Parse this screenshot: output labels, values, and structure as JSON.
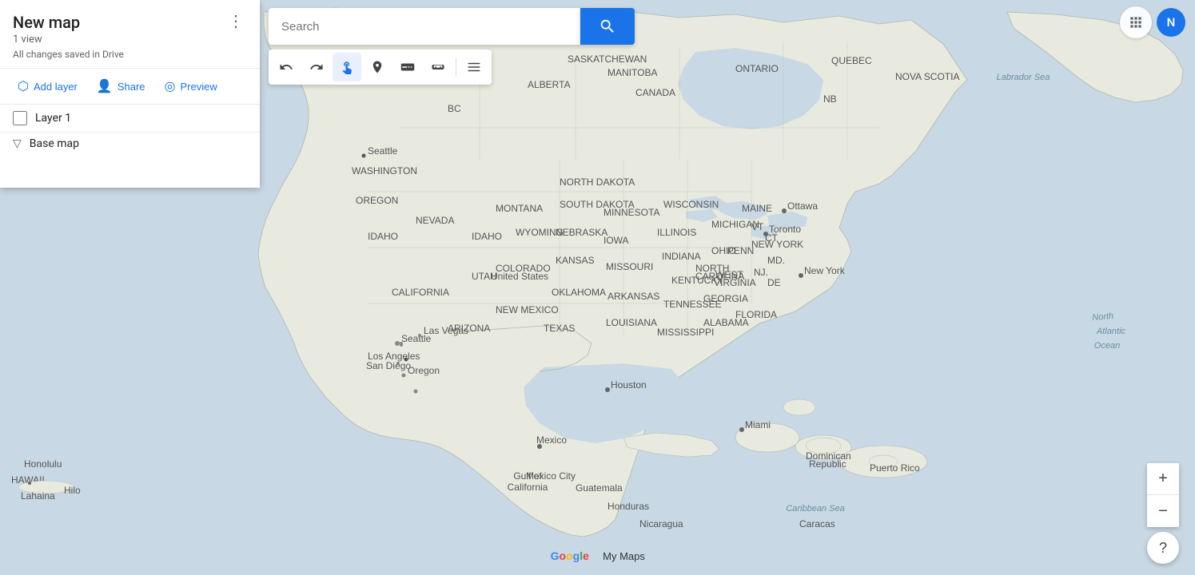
{
  "app": {
    "title": "Google My Maps",
    "logo_text": "Google",
    "my_maps_label": "My Maps"
  },
  "panel": {
    "title": "New map",
    "subtitle": "1 view",
    "saved_text": "All changes saved in Drive",
    "more_button_label": "⋮",
    "actions": {
      "add_layer_label": "Add layer",
      "share_label": "Share",
      "preview_label": "Preview"
    },
    "layer": {
      "name": "Layer 1",
      "checked": false
    },
    "base_map": {
      "label": "Base map"
    }
  },
  "search": {
    "placeholder": "Search",
    "value": ""
  },
  "toolbar": {
    "undo_label": "↩",
    "redo_label": "↪",
    "hand_label": "✋",
    "marker_label": "📍",
    "line_label": "〰",
    "measure_label": "📏"
  },
  "top_bar": {
    "apps_icon": "⠿",
    "avatar_letter": "N",
    "avatar_color": "#1a73e8"
  },
  "zoom": {
    "in_label": "+",
    "out_label": "−"
  },
  "help": {
    "label": "?"
  }
}
